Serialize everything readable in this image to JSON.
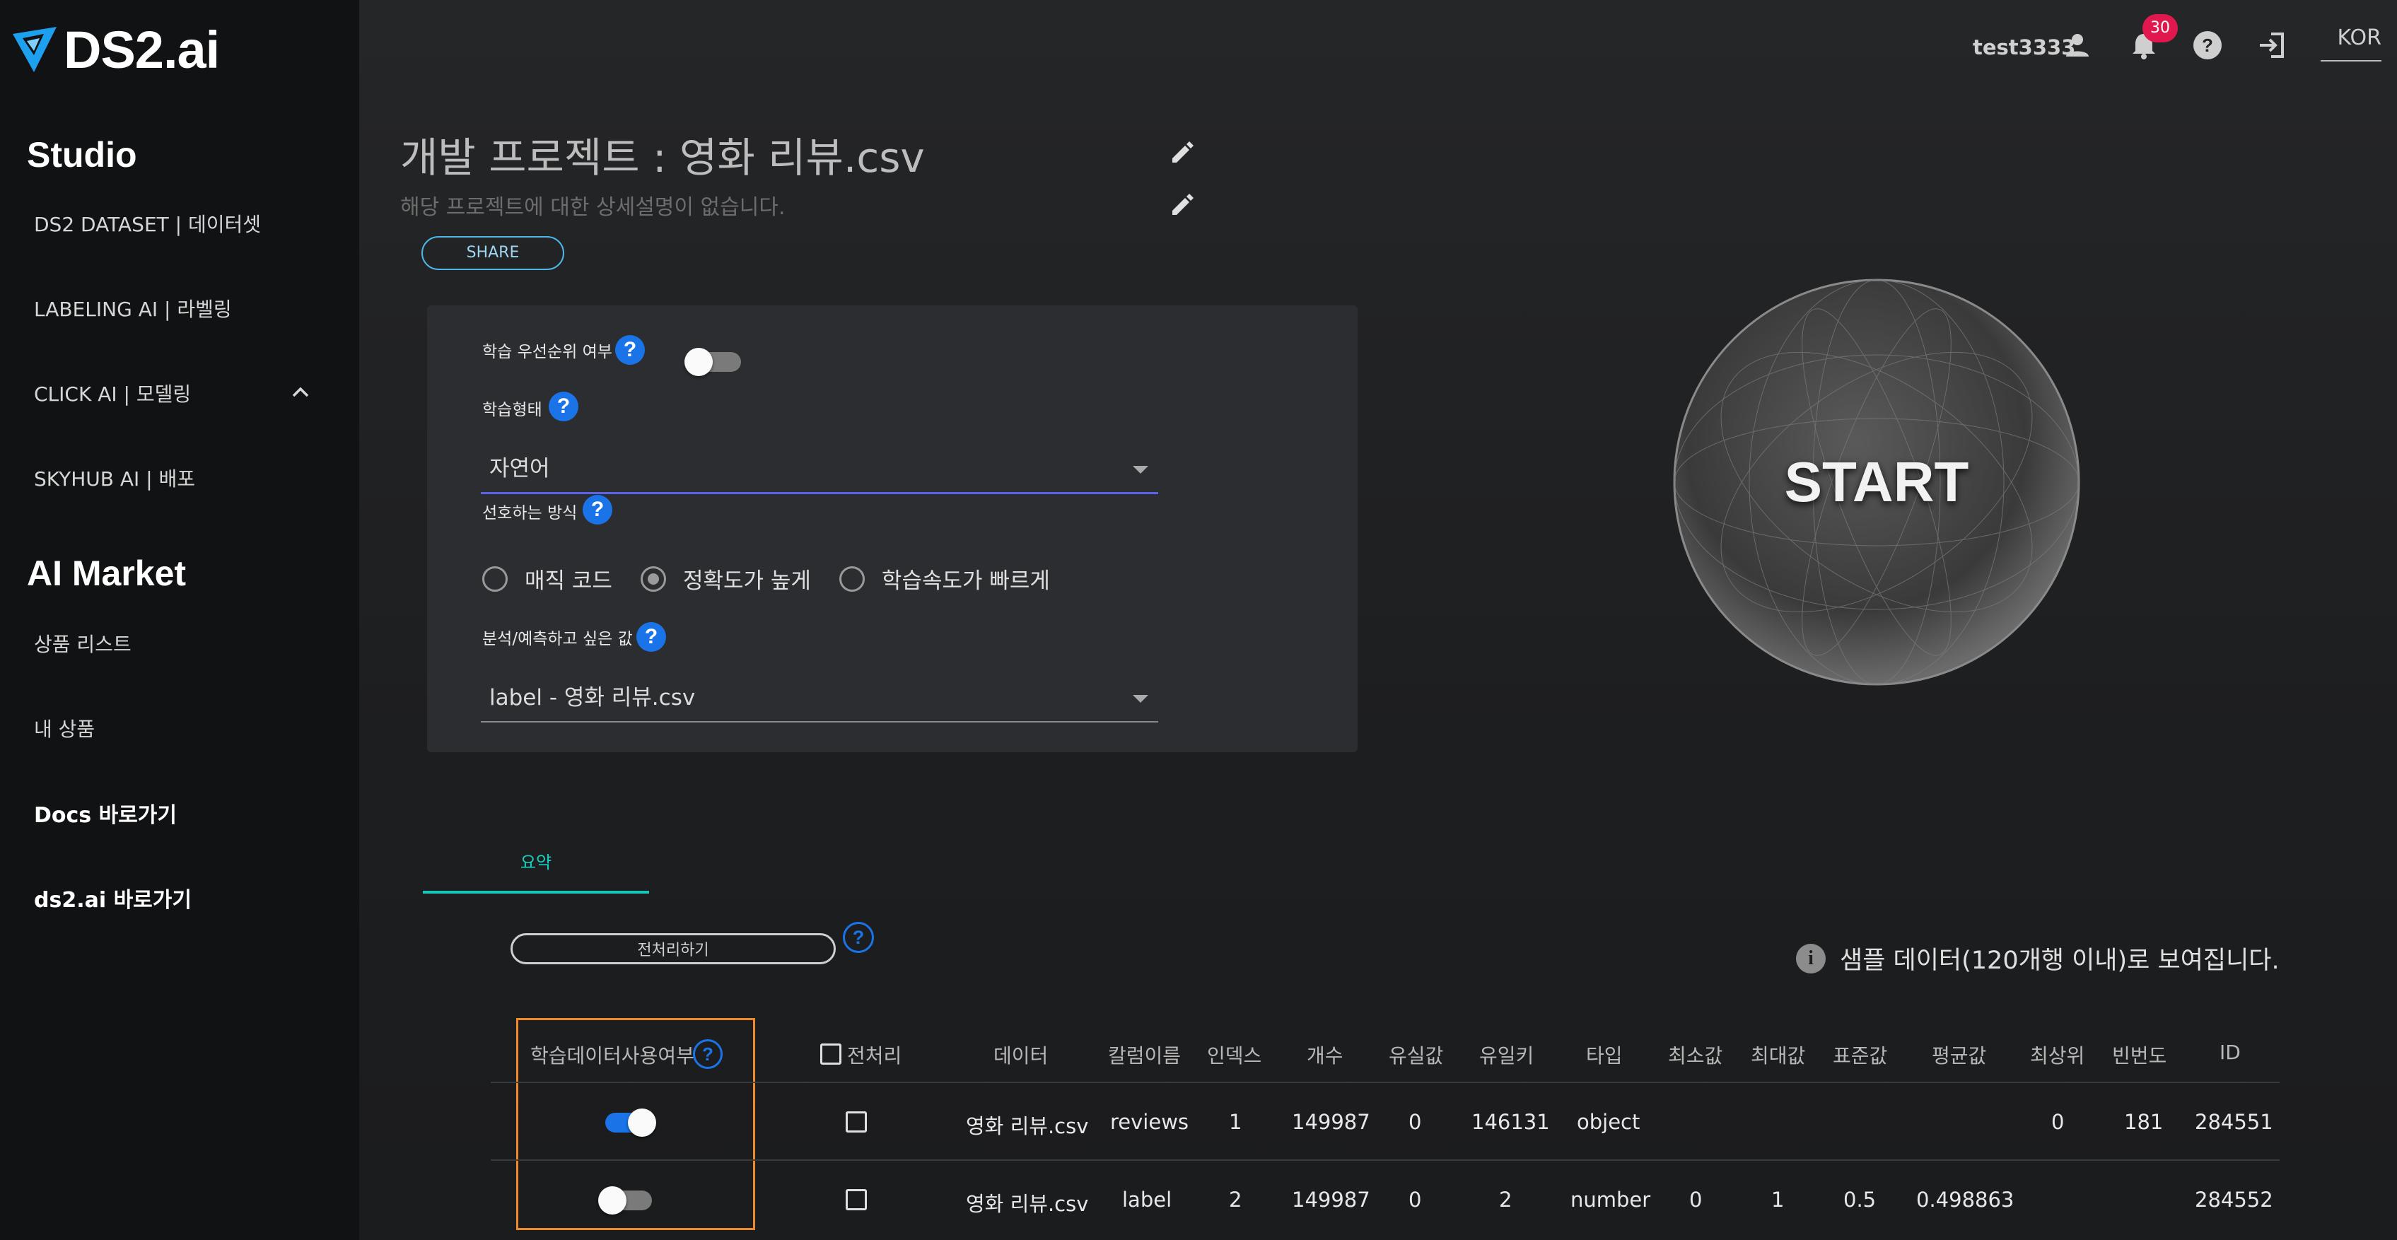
{
  "app": {
    "logo_text": "DS2.ai"
  },
  "sidebar": {
    "studio_title": "Studio",
    "studio_items": [
      {
        "label": "DS2 DATASET | 데이터셋"
      },
      {
        "label": "LABELING AI | 라벨링"
      },
      {
        "label": "CLICK AI | 모델링"
      },
      {
        "label": "SKYHUB AI | 배포"
      }
    ],
    "market_title": "AI Market",
    "market_items": [
      {
        "label": "상품 리스트"
      },
      {
        "label": "내 상품"
      }
    ],
    "links": [
      {
        "label": "Docs 바로가기"
      },
      {
        "label": "ds2.ai 바로가기"
      }
    ]
  },
  "topbar": {
    "username": "test3333",
    "notification_count": "30",
    "language": "KOR"
  },
  "project": {
    "title": "개발 프로젝트 : 영화 리뷰.csv",
    "description": "해당 프로젝트에 대한 상세설명이 없습니다.",
    "share_label": "SHARE"
  },
  "settings": {
    "priority_label": "학습 우선순위 여부",
    "priority_on": false,
    "training_type_label": "학습형태",
    "training_type_value": "자연어",
    "method_label": "선호하는 방식",
    "method_options": [
      {
        "label": "매직 코드",
        "selected": false
      },
      {
        "label": "정확도가 높게",
        "selected": true
      },
      {
        "label": "학습속도가 빠르게",
        "selected": false
      }
    ],
    "target_label": "분석/예측하고 싶은 값",
    "target_value": "label - 영화 리뷰.csv",
    "help_glyph": "?"
  },
  "start_button": {
    "label": "START"
  },
  "tabs": [
    {
      "label": "요약",
      "active": true
    }
  ],
  "preprocess_button": {
    "label": "전처리하기"
  },
  "sample_note": "샘플 데이터(120개행 이내)로 보여집니다.",
  "table": {
    "headers": {
      "use": "학습데이터사용여부",
      "preprocess": "전처리",
      "data": "데이터",
      "column": "칼럼이름",
      "index": "인덱스",
      "count": "개수",
      "missing": "유실값",
      "unique": "유일키",
      "type": "타입",
      "min": "최소값",
      "max": "최대값",
      "std": "표준값",
      "mean": "평균값",
      "top": "최상위",
      "freq": "빈번도",
      "id": "ID"
    },
    "rows": [
      {
        "use": true,
        "preprocess": false,
        "data": "영화 리뷰.csv",
        "column": "reviews",
        "index": "1",
        "count": "149987",
        "missing": "0",
        "unique": "146131",
        "type": "object",
        "min": "",
        "max": "",
        "std": "",
        "mean": "",
        "top": "0",
        "freq": "181",
        "id": "284551"
      },
      {
        "use": false,
        "preprocess": false,
        "data": "영화 리뷰.csv",
        "column": "label",
        "index": "2",
        "count": "149987",
        "missing": "0",
        "unique": "2",
        "type": "number",
        "min": "0",
        "max": "1",
        "std": "0.5",
        "mean": "0.498863",
        "top": "",
        "freq": "",
        "id": "284552"
      }
    ]
  },
  "colors": {
    "accent_blue": "#1a74e8",
    "accent_teal": "#16c8b8",
    "highlight_orange": "#f0892c",
    "badge_red": "#e0184e"
  }
}
